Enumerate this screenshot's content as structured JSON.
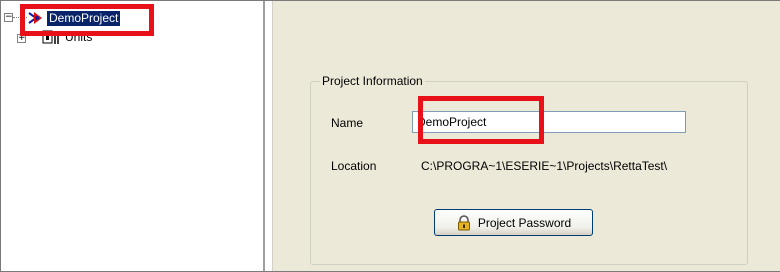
{
  "tree": {
    "root": {
      "label": "DemoProject",
      "expander": "−"
    },
    "children": [
      {
        "label": "Units",
        "expander": "+"
      }
    ]
  },
  "project_info": {
    "group_title": "Project Information",
    "name_label": "Name",
    "name_value": "DemoProject",
    "location_label": "Location",
    "location_value": "C:\\PROGRA~1\\ESERIE~1\\Projects\\RettaTest\\",
    "password_button": "Project Password"
  },
  "colors": {
    "highlight": "#e8111a",
    "selection": "#0a246a",
    "panel_bg": "#ece9d8"
  },
  "icons": [
    "project-icon",
    "units-folder-icon",
    "lock-icon"
  ]
}
